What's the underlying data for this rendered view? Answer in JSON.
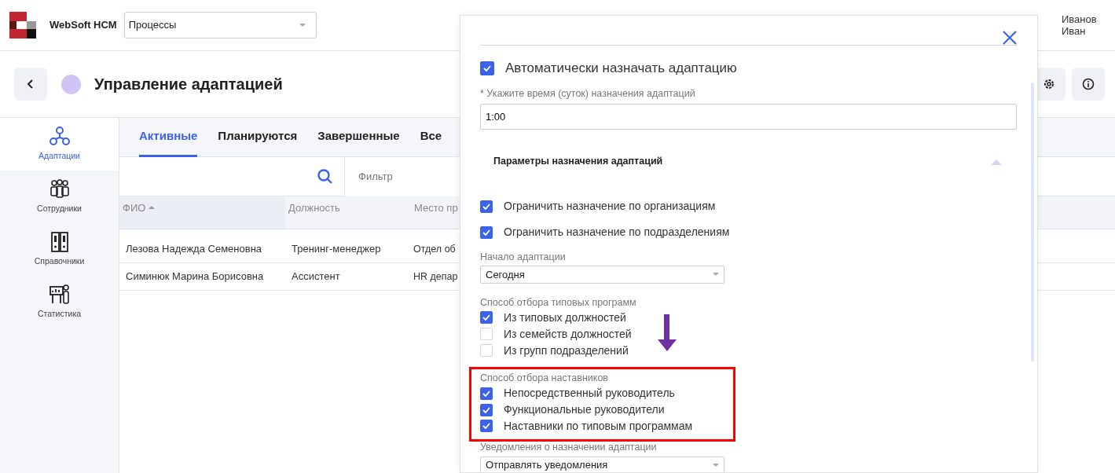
{
  "header": {
    "brand": "WebSoft HCM",
    "process_select": {
      "value": "Процессы"
    },
    "user": {
      "name": "Иванов Иван"
    }
  },
  "page": {
    "title": "Управление адаптацией"
  },
  "sidebar": {
    "items": [
      {
        "label": "Адаптации",
        "kind": "hierarchy",
        "selected": true
      },
      {
        "label": "Сотрудники",
        "kind": "people",
        "selected": false
      },
      {
        "label": "Справочники",
        "kind": "binders",
        "selected": false
      },
      {
        "label": "Статистика",
        "kind": "presenter",
        "selected": false
      }
    ]
  },
  "tabs": [
    {
      "label": "Активные",
      "selected": true
    },
    {
      "label": "Планируются",
      "selected": false
    },
    {
      "label": "Завершенные",
      "selected": false
    },
    {
      "label": "Все",
      "selected": false
    }
  ],
  "filter": {
    "placeholder": "Фильтр"
  },
  "table": {
    "columns": [
      {
        "label": "ФИО",
        "sorted": true
      },
      {
        "label": "Должность",
        "sorted": false
      },
      {
        "label": "Место пр",
        "sorted": false
      }
    ],
    "rows": [
      [
        "Лезова Надежда Семеновна",
        "Тренинг-менеджер",
        "Отдел об"
      ],
      [
        "Симинюк Марина Борисовна",
        "Ассистент",
        "HR депар"
      ]
    ]
  },
  "dialog": {
    "auto_assign": {
      "label": "Автоматически назначать адаптацию",
      "checked": true
    },
    "time_field": {
      "label": "* Укажите время (суток) назначения адаптаций",
      "value": "1:00"
    },
    "section": {
      "title": "Параметры назначения адаптаций",
      "expanded": true
    },
    "restrictions": [
      {
        "label": "Ограничить назначение по организациям",
        "checked": true
      },
      {
        "label": "Ограничить назначение по подразделениям",
        "checked": true
      }
    ],
    "start": {
      "label": "Начало адаптации",
      "value": "Сегодня"
    },
    "groups": [
      {
        "title": "Способ отбора типовых программ",
        "highlighted": false,
        "options": [
          {
            "label": "Из типовых должностей",
            "checked": true
          },
          {
            "label": "Из семейств должностей",
            "checked": false
          },
          {
            "label": "Из групп подразделений",
            "checked": false
          }
        ]
      },
      {
        "title": "Способ отбора наставников",
        "highlighted": true,
        "options": [
          {
            "label": "Непосредственный руководитель",
            "checked": true
          },
          {
            "label": "Функциональные руководители",
            "checked": true
          },
          {
            "label": "Наставники по типовым программам",
            "checked": true
          }
        ]
      }
    ],
    "notifications": {
      "label": "Уведомления о назначении адаптации",
      "value": "Отправлять уведомления"
    }
  }
}
